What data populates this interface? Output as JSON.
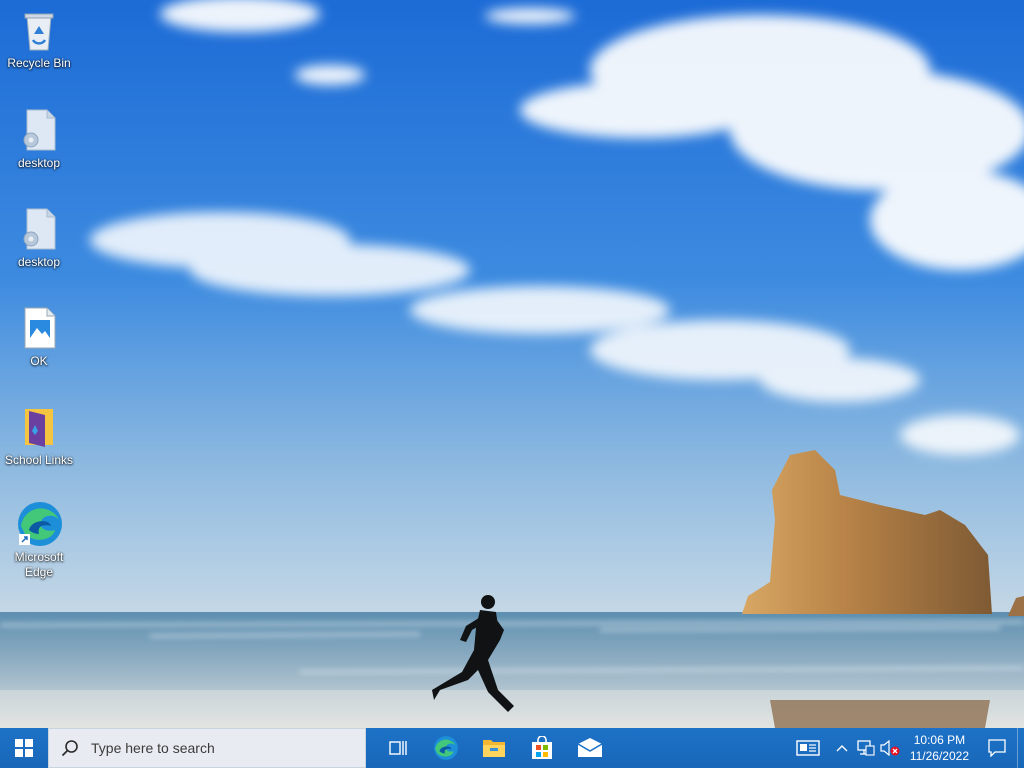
{
  "desktop": {
    "icons": [
      {
        "label": "Recycle Bin",
        "icon": "recycle-bin-icon"
      },
      {
        "label": "desktop",
        "icon": "settings-file-icon"
      },
      {
        "label": "desktop",
        "icon": "settings-file-icon"
      },
      {
        "label": "OK",
        "icon": "image-file-icon"
      },
      {
        "label": "School Links",
        "icon": "folder-icon"
      },
      {
        "label": "Microsoft Edge",
        "icon": "edge-icon"
      }
    ]
  },
  "taskbar": {
    "search": {
      "placeholder": "Type here to search"
    },
    "pinned": [
      {
        "name": "task-view",
        "icon": "task-view-icon"
      },
      {
        "name": "edge",
        "icon": "edge-icon"
      },
      {
        "name": "file-explorer",
        "icon": "folder-icon"
      },
      {
        "name": "microsoft-store",
        "icon": "store-icon"
      },
      {
        "name": "mail",
        "icon": "mail-icon"
      }
    ],
    "tray": {
      "icons": [
        "news-icon",
        "chevron-up-icon",
        "network-icon",
        "volume-muted-icon"
      ],
      "time": "10:06 PM",
      "date": "11/26/2022"
    }
  },
  "colors": {
    "taskbar": "#1a6fc4",
    "sky_top": "#1f6fd6",
    "sky_bottom": "#b7d2e6"
  }
}
